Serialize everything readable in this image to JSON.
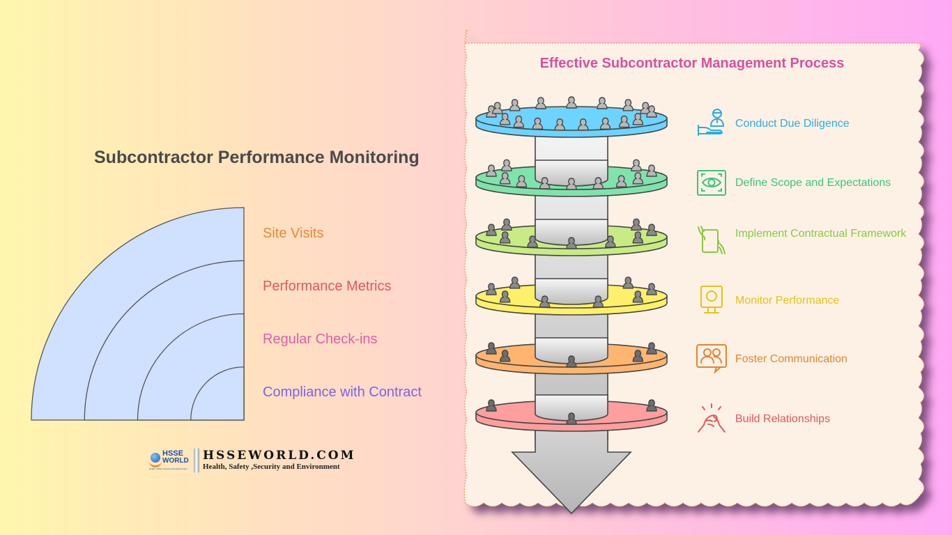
{
  "left": {
    "title": "Subcontractor Performance Monitoring",
    "rings": [
      {
        "label": "Site Visits",
        "color": "#E08A3C"
      },
      {
        "label": "Performance Metrics",
        "color": "#E0585F"
      },
      {
        "label": "Regular Check-ins",
        "color": "#DC60A8"
      },
      {
        "label": "Compliance with Contract",
        "color": "#7B63E6"
      }
    ],
    "fill_color": "#D0E0FF"
  },
  "logo": {
    "badge_top": "HSSE",
    "badge_bottom": "WORLD",
    "badge_tagline": "Health, Safety, Security and Environment",
    "site": "HSSEWORLD.COM",
    "subtitle": "Health, Safety ,Security and Environment"
  },
  "panel": {
    "title": "Effective Subcontractor Management Process",
    "title_color": "#D94FA0",
    "steps": [
      {
        "label": "Conduct Due Diligence",
        "icon": "handshake-person-icon",
        "color": "#2AACE2",
        "layer_color": "#6DD4FF"
      },
      {
        "label": "Define Scope and Expectations",
        "icon": "eye-frame-icon",
        "color": "#3CC47A",
        "layer_color": "#7FE3AC"
      },
      {
        "label": "Implement Contractual Framework",
        "icon": "document-hands-icon",
        "color": "#8DC63F",
        "layer_color": "#C8EB85"
      },
      {
        "label": "Monitor Performance",
        "icon": "monitor-icon",
        "color": "#E2C411",
        "layer_color": "#FFF06A"
      },
      {
        "label": "Foster Communication",
        "icon": "chat-people-icon",
        "color": "#E0852E",
        "layer_color": "#FFB570"
      },
      {
        "label": "Build Relationships",
        "icon": "clasped-hands-icon",
        "color": "#E0585F",
        "layer_color": "#FF9E9E"
      }
    ]
  }
}
